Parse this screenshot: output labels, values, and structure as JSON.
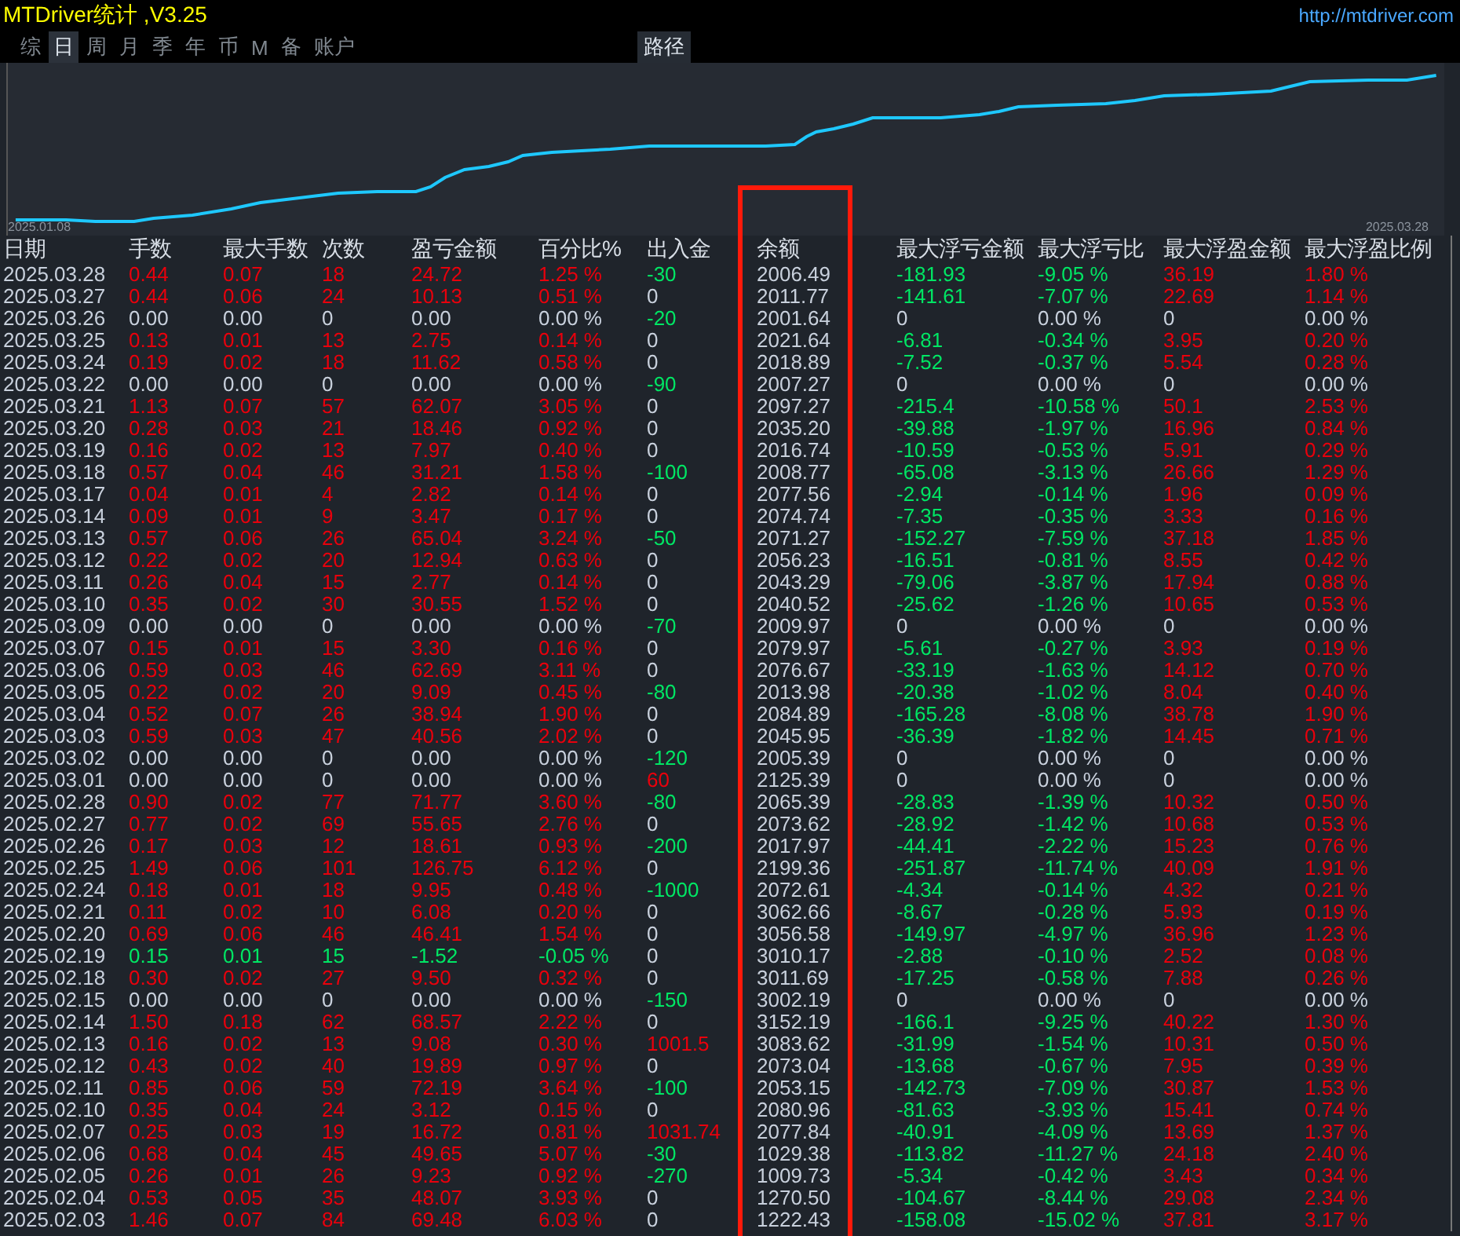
{
  "title": "MTDriver统计 ,V3.25",
  "link": "http://mtdriver.com",
  "tabs": [
    {
      "label": "综",
      "selected": false
    },
    {
      "label": "日",
      "selected": true
    },
    {
      "label": "周",
      "selected": false
    },
    {
      "label": "月",
      "selected": false
    },
    {
      "label": "季",
      "selected": false
    },
    {
      "label": "年",
      "selected": false
    },
    {
      "label": "币",
      "selected": false
    },
    {
      "label": "M",
      "selected": false
    },
    {
      "label": "备",
      "selected": false
    },
    {
      "label": "账户",
      "selected": false
    }
  ],
  "path_button": "路径",
  "chart": {
    "start_label": "2025.01.08",
    "end_label": "2025.03.28"
  },
  "columns": [
    "日期",
    "手数",
    "最大手数",
    "次数",
    "盈亏金额",
    "百分比%",
    "出入金",
    "余额",
    "最大浮亏金额",
    "最大浮亏比",
    "最大浮盈金额",
    "最大浮盈比例"
  ],
  "rows": [
    {
      "date": "2025.03.28",
      "trade": {
        "color": "#e8000c",
        "cells": [
          "0.44",
          "0.07",
          "18",
          "24.72",
          "1.25 %"
        ]
      },
      "cash": {
        "text": "-30",
        "color": "#00e664"
      },
      "balance": "2006.49",
      "float_loss": {
        "color": "#00e664",
        "cells": [
          "-181.93",
          "-9.05 %"
        ]
      },
      "float_profit": {
        "color": "#e8000c",
        "cells": [
          "36.19",
          "1.80 %"
        ]
      }
    },
    {
      "date": "2025.03.27",
      "trade": {
        "color": "#e8000c",
        "cells": [
          "0.44",
          "0.06",
          "24",
          "10.13",
          "0.51 %"
        ]
      },
      "cash": {
        "text": "0",
        "color": "#c8d0dc"
      },
      "balance": "2011.77",
      "float_loss": {
        "color": "#00e664",
        "cells": [
          "-141.61",
          "-7.07 %"
        ]
      },
      "float_profit": {
        "color": "#e8000c",
        "cells": [
          "22.69",
          "1.14 %"
        ]
      }
    },
    {
      "date": "2025.03.26",
      "trade": {
        "color": "#c8d0dc",
        "cells": [
          "0.00",
          "0.00",
          "0",
          "0.00",
          "0.00 %"
        ]
      },
      "cash": {
        "text": "-20",
        "color": "#00e664"
      },
      "balance": "2001.64",
      "float_loss": {
        "color": "#c8d0dc",
        "cells": [
          "0",
          "0.00 %"
        ]
      },
      "float_profit": {
        "color": "#c8d0dc",
        "cells": [
          "0",
          "0.00 %"
        ]
      }
    },
    {
      "date": "2025.03.25",
      "trade": {
        "color": "#e8000c",
        "cells": [
          "0.13",
          "0.01",
          "13",
          "2.75",
          "0.14 %"
        ]
      },
      "cash": {
        "text": "0",
        "color": "#c8d0dc"
      },
      "balance": "2021.64",
      "float_loss": {
        "color": "#00e664",
        "cells": [
          "-6.81",
          "-0.34 %"
        ]
      },
      "float_profit": {
        "color": "#e8000c",
        "cells": [
          "3.95",
          "0.20 %"
        ]
      }
    },
    {
      "date": "2025.03.24",
      "trade": {
        "color": "#e8000c",
        "cells": [
          "0.19",
          "0.02",
          "18",
          "11.62",
          "0.58 %"
        ]
      },
      "cash": {
        "text": "0",
        "color": "#c8d0dc"
      },
      "balance": "2018.89",
      "float_loss": {
        "color": "#00e664",
        "cells": [
          "-7.52",
          "-0.37 %"
        ]
      },
      "float_profit": {
        "color": "#e8000c",
        "cells": [
          "5.54",
          "0.28 %"
        ]
      }
    },
    {
      "date": "2025.03.22",
      "trade": {
        "color": "#c8d0dc",
        "cells": [
          "0.00",
          "0.00",
          "0",
          "0.00",
          "0.00 %"
        ]
      },
      "cash": {
        "text": "-90",
        "color": "#00e664"
      },
      "balance": "2007.27",
      "float_loss": {
        "color": "#c8d0dc",
        "cells": [
          "0",
          "0.00 %"
        ]
      },
      "float_profit": {
        "color": "#c8d0dc",
        "cells": [
          "0",
          "0.00 %"
        ]
      }
    },
    {
      "date": "2025.03.21",
      "trade": {
        "color": "#e8000c",
        "cells": [
          "1.13",
          "0.07",
          "57",
          "62.07",
          "3.05 %"
        ]
      },
      "cash": {
        "text": "0",
        "color": "#c8d0dc"
      },
      "balance": "2097.27",
      "float_loss": {
        "color": "#00e664",
        "cells": [
          "-215.4",
          "-10.58 %"
        ]
      },
      "float_profit": {
        "color": "#e8000c",
        "cells": [
          "50.1",
          "2.53 %"
        ]
      }
    },
    {
      "date": "2025.03.20",
      "trade": {
        "color": "#e8000c",
        "cells": [
          "0.28",
          "0.03",
          "21",
          "18.46",
          "0.92 %"
        ]
      },
      "cash": {
        "text": "0",
        "color": "#c8d0dc"
      },
      "balance": "2035.20",
      "float_loss": {
        "color": "#00e664",
        "cells": [
          "-39.88",
          "-1.97 %"
        ]
      },
      "float_profit": {
        "color": "#e8000c",
        "cells": [
          "16.96",
          "0.84 %"
        ]
      }
    },
    {
      "date": "2025.03.19",
      "trade": {
        "color": "#e8000c",
        "cells": [
          "0.16",
          "0.02",
          "13",
          "7.97",
          "0.40 %"
        ]
      },
      "cash": {
        "text": "0",
        "color": "#c8d0dc"
      },
      "balance": "2016.74",
      "float_loss": {
        "color": "#00e664",
        "cells": [
          "-10.59",
          "-0.53 %"
        ]
      },
      "float_profit": {
        "color": "#e8000c",
        "cells": [
          "5.91",
          "0.29 %"
        ]
      }
    },
    {
      "date": "2025.03.18",
      "trade": {
        "color": "#e8000c",
        "cells": [
          "0.57",
          "0.04",
          "46",
          "31.21",
          "1.58 %"
        ]
      },
      "cash": {
        "text": "-100",
        "color": "#00e664"
      },
      "balance": "2008.77",
      "float_loss": {
        "color": "#00e664",
        "cells": [
          "-65.08",
          "-3.13 %"
        ]
      },
      "float_profit": {
        "color": "#e8000c",
        "cells": [
          "26.66",
          "1.29 %"
        ]
      }
    },
    {
      "date": "2025.03.17",
      "trade": {
        "color": "#e8000c",
        "cells": [
          "0.04",
          "0.01",
          "4",
          "2.82",
          "0.14 %"
        ]
      },
      "cash": {
        "text": "0",
        "color": "#c8d0dc"
      },
      "balance": "2077.56",
      "float_loss": {
        "color": "#00e664",
        "cells": [
          "-2.94",
          "-0.14 %"
        ]
      },
      "float_profit": {
        "color": "#e8000c",
        "cells": [
          "1.96",
          "0.09 %"
        ]
      }
    },
    {
      "date": "2025.03.14",
      "trade": {
        "color": "#e8000c",
        "cells": [
          "0.09",
          "0.01",
          "9",
          "3.47",
          "0.17 %"
        ]
      },
      "cash": {
        "text": "0",
        "color": "#c8d0dc"
      },
      "balance": "2074.74",
      "float_loss": {
        "color": "#00e664",
        "cells": [
          "-7.35",
          "-0.35 %"
        ]
      },
      "float_profit": {
        "color": "#e8000c",
        "cells": [
          "3.33",
          "0.16 %"
        ]
      }
    },
    {
      "date": "2025.03.13",
      "trade": {
        "color": "#e8000c",
        "cells": [
          "0.57",
          "0.06",
          "26",
          "65.04",
          "3.24 %"
        ]
      },
      "cash": {
        "text": "-50",
        "color": "#00e664"
      },
      "balance": "2071.27",
      "float_loss": {
        "color": "#00e664",
        "cells": [
          "-152.27",
          "-7.59 %"
        ]
      },
      "float_profit": {
        "color": "#e8000c",
        "cells": [
          "37.18",
          "1.85 %"
        ]
      }
    },
    {
      "date": "2025.03.12",
      "trade": {
        "color": "#e8000c",
        "cells": [
          "0.22",
          "0.02",
          "20",
          "12.94",
          "0.63 %"
        ]
      },
      "cash": {
        "text": "0",
        "color": "#c8d0dc"
      },
      "balance": "2056.23",
      "float_loss": {
        "color": "#00e664",
        "cells": [
          "-16.51",
          "-0.81 %"
        ]
      },
      "float_profit": {
        "color": "#e8000c",
        "cells": [
          "8.55",
          "0.42 %"
        ]
      }
    },
    {
      "date": "2025.03.11",
      "trade": {
        "color": "#e8000c",
        "cells": [
          "0.26",
          "0.04",
          "15",
          "2.77",
          "0.14 %"
        ]
      },
      "cash": {
        "text": "0",
        "color": "#c8d0dc"
      },
      "balance": "2043.29",
      "float_loss": {
        "color": "#00e664",
        "cells": [
          "-79.06",
          "-3.87 %"
        ]
      },
      "float_profit": {
        "color": "#e8000c",
        "cells": [
          "17.94",
          "0.88 %"
        ]
      }
    },
    {
      "date": "2025.03.10",
      "trade": {
        "color": "#e8000c",
        "cells": [
          "0.35",
          "0.02",
          "30",
          "30.55",
          "1.52 %"
        ]
      },
      "cash": {
        "text": "0",
        "color": "#c8d0dc"
      },
      "balance": "2040.52",
      "float_loss": {
        "color": "#00e664",
        "cells": [
          "-25.62",
          "-1.26 %"
        ]
      },
      "float_profit": {
        "color": "#e8000c",
        "cells": [
          "10.65",
          "0.53 %"
        ]
      }
    },
    {
      "date": "2025.03.09",
      "trade": {
        "color": "#c8d0dc",
        "cells": [
          "0.00",
          "0.00",
          "0",
          "0.00",
          "0.00 %"
        ]
      },
      "cash": {
        "text": "-70",
        "color": "#00e664"
      },
      "balance": "2009.97",
      "float_loss": {
        "color": "#c8d0dc",
        "cells": [
          "0",
          "0.00 %"
        ]
      },
      "float_profit": {
        "color": "#c8d0dc",
        "cells": [
          "0",
          "0.00 %"
        ]
      }
    },
    {
      "date": "2025.03.07",
      "trade": {
        "color": "#e8000c",
        "cells": [
          "0.15",
          "0.01",
          "15",
          "3.30",
          "0.16 %"
        ]
      },
      "cash": {
        "text": "0",
        "color": "#c8d0dc"
      },
      "balance": "2079.97",
      "float_loss": {
        "color": "#00e664",
        "cells": [
          "-5.61",
          "-0.27 %"
        ]
      },
      "float_profit": {
        "color": "#e8000c",
        "cells": [
          "3.93",
          "0.19 %"
        ]
      }
    },
    {
      "date": "2025.03.06",
      "trade": {
        "color": "#e8000c",
        "cells": [
          "0.59",
          "0.03",
          "46",
          "62.69",
          "3.11 %"
        ]
      },
      "cash": {
        "text": "0",
        "color": "#c8d0dc"
      },
      "balance": "2076.67",
      "float_loss": {
        "color": "#00e664",
        "cells": [
          "-33.19",
          "-1.63 %"
        ]
      },
      "float_profit": {
        "color": "#e8000c",
        "cells": [
          "14.12",
          "0.70 %"
        ]
      }
    },
    {
      "date": "2025.03.05",
      "trade": {
        "color": "#e8000c",
        "cells": [
          "0.22",
          "0.02",
          "20",
          "9.09",
          "0.45 %"
        ]
      },
      "cash": {
        "text": "-80",
        "color": "#00e664"
      },
      "balance": "2013.98",
      "float_loss": {
        "color": "#00e664",
        "cells": [
          "-20.38",
          "-1.02 %"
        ]
      },
      "float_profit": {
        "color": "#e8000c",
        "cells": [
          "8.04",
          "0.40 %"
        ]
      }
    },
    {
      "date": "2025.03.04",
      "trade": {
        "color": "#e8000c",
        "cells": [
          "0.52",
          "0.07",
          "26",
          "38.94",
          "1.90 %"
        ]
      },
      "cash": {
        "text": "0",
        "color": "#c8d0dc"
      },
      "balance": "2084.89",
      "float_loss": {
        "color": "#00e664",
        "cells": [
          "-165.28",
          "-8.08 %"
        ]
      },
      "float_profit": {
        "color": "#e8000c",
        "cells": [
          "38.78",
          "1.90 %"
        ]
      }
    },
    {
      "date": "2025.03.03",
      "trade": {
        "color": "#e8000c",
        "cells": [
          "0.59",
          "0.03",
          "47",
          "40.56",
          "2.02 %"
        ]
      },
      "cash": {
        "text": "0",
        "color": "#c8d0dc"
      },
      "balance": "2045.95",
      "float_loss": {
        "color": "#00e664",
        "cells": [
          "-36.39",
          "-1.82 %"
        ]
      },
      "float_profit": {
        "color": "#e8000c",
        "cells": [
          "14.45",
          "0.71 %"
        ]
      }
    },
    {
      "date": "2025.03.02",
      "trade": {
        "color": "#c8d0dc",
        "cells": [
          "0.00",
          "0.00",
          "0",
          "0.00",
          "0.00 %"
        ]
      },
      "cash": {
        "text": "-120",
        "color": "#00e664"
      },
      "balance": "2005.39",
      "float_loss": {
        "color": "#c8d0dc",
        "cells": [
          "0",
          "0.00 %"
        ]
      },
      "float_profit": {
        "color": "#c8d0dc",
        "cells": [
          "0",
          "0.00 %"
        ]
      }
    },
    {
      "date": "2025.03.01",
      "trade": {
        "color": "#c8d0dc",
        "cells": [
          "0.00",
          "0.00",
          "0",
          "0.00",
          "0.00 %"
        ]
      },
      "cash": {
        "text": "60",
        "color": "#e8000c"
      },
      "balance": "2125.39",
      "float_loss": {
        "color": "#c8d0dc",
        "cells": [
          "0",
          "0.00 %"
        ]
      },
      "float_profit": {
        "color": "#c8d0dc",
        "cells": [
          "0",
          "0.00 %"
        ]
      }
    },
    {
      "date": "2025.02.28",
      "trade": {
        "color": "#e8000c",
        "cells": [
          "0.90",
          "0.02",
          "77",
          "71.77",
          "3.60 %"
        ]
      },
      "cash": {
        "text": "-80",
        "color": "#00e664"
      },
      "balance": "2065.39",
      "float_loss": {
        "color": "#00e664",
        "cells": [
          "-28.83",
          "-1.39 %"
        ]
      },
      "float_profit": {
        "color": "#e8000c",
        "cells": [
          "10.32",
          "0.50 %"
        ]
      }
    },
    {
      "date": "2025.02.27",
      "trade": {
        "color": "#e8000c",
        "cells": [
          "0.77",
          "0.02",
          "69",
          "55.65",
          "2.76 %"
        ]
      },
      "cash": {
        "text": "0",
        "color": "#c8d0dc"
      },
      "balance": "2073.62",
      "float_loss": {
        "color": "#00e664",
        "cells": [
          "-28.92",
          "-1.42 %"
        ]
      },
      "float_profit": {
        "color": "#e8000c",
        "cells": [
          "10.68",
          "0.53 %"
        ]
      }
    },
    {
      "date": "2025.02.26",
      "trade": {
        "color": "#e8000c",
        "cells": [
          "0.17",
          "0.03",
          "12",
          "18.61",
          "0.93 %"
        ]
      },
      "cash": {
        "text": "-200",
        "color": "#00e664"
      },
      "balance": "2017.97",
      "float_loss": {
        "color": "#00e664",
        "cells": [
          "-44.41",
          "-2.22 %"
        ]
      },
      "float_profit": {
        "color": "#e8000c",
        "cells": [
          "15.23",
          "0.76 %"
        ]
      }
    },
    {
      "date": "2025.02.25",
      "trade": {
        "color": "#e8000c",
        "cells": [
          "1.49",
          "0.06",
          "101",
          "126.75",
          "6.12 %"
        ]
      },
      "cash": {
        "text": "0",
        "color": "#c8d0dc"
      },
      "balance": "2199.36",
      "float_loss": {
        "color": "#00e664",
        "cells": [
          "-251.87",
          "-11.74 %"
        ]
      },
      "float_profit": {
        "color": "#e8000c",
        "cells": [
          "40.09",
          "1.91 %"
        ]
      }
    },
    {
      "date": "2025.02.24",
      "trade": {
        "color": "#e8000c",
        "cells": [
          "0.18",
          "0.01",
          "18",
          "9.95",
          "0.48 %"
        ]
      },
      "cash": {
        "text": "-1000",
        "color": "#00e664"
      },
      "balance": "2072.61",
      "float_loss": {
        "color": "#00e664",
        "cells": [
          "-4.34",
          "-0.14 %"
        ]
      },
      "float_profit": {
        "color": "#e8000c",
        "cells": [
          "4.32",
          "0.21 %"
        ]
      }
    },
    {
      "date": "2025.02.21",
      "trade": {
        "color": "#e8000c",
        "cells": [
          "0.11",
          "0.02",
          "10",
          "6.08",
          "0.20 %"
        ]
      },
      "cash": {
        "text": "0",
        "color": "#c8d0dc"
      },
      "balance": "3062.66",
      "float_loss": {
        "color": "#00e664",
        "cells": [
          "-8.67",
          "-0.28 %"
        ]
      },
      "float_profit": {
        "color": "#e8000c",
        "cells": [
          "5.93",
          "0.19 %"
        ]
      }
    },
    {
      "date": "2025.02.20",
      "trade": {
        "color": "#e8000c",
        "cells": [
          "0.69",
          "0.06",
          "46",
          "46.41",
          "1.54 %"
        ]
      },
      "cash": {
        "text": "0",
        "color": "#c8d0dc"
      },
      "balance": "3056.58",
      "float_loss": {
        "color": "#00e664",
        "cells": [
          "-149.97",
          "-4.97 %"
        ]
      },
      "float_profit": {
        "color": "#e8000c",
        "cells": [
          "36.96",
          "1.23 %"
        ]
      }
    },
    {
      "date": "2025.02.19",
      "trade": {
        "color": "#00e664",
        "cells": [
          "0.15",
          "0.01",
          "15",
          "-1.52",
          "-0.05 %"
        ]
      },
      "cash": {
        "text": "0",
        "color": "#c8d0dc"
      },
      "balance": "3010.17",
      "float_loss": {
        "color": "#00e664",
        "cells": [
          "-2.88",
          "-0.10 %"
        ]
      },
      "float_profit": {
        "color": "#e8000c",
        "cells": [
          "2.52",
          "0.08 %"
        ]
      }
    },
    {
      "date": "2025.02.18",
      "trade": {
        "color": "#e8000c",
        "cells": [
          "0.30",
          "0.02",
          "27",
          "9.50",
          "0.32 %"
        ]
      },
      "cash": {
        "text": "0",
        "color": "#c8d0dc"
      },
      "balance": "3011.69",
      "float_loss": {
        "color": "#00e664",
        "cells": [
          "-17.25",
          "-0.58 %"
        ]
      },
      "float_profit": {
        "color": "#e8000c",
        "cells": [
          "7.88",
          "0.26 %"
        ]
      }
    },
    {
      "date": "2025.02.15",
      "trade": {
        "color": "#c8d0dc",
        "cells": [
          "0.00",
          "0.00",
          "0",
          "0.00",
          "0.00 %"
        ]
      },
      "cash": {
        "text": "-150",
        "color": "#00e664"
      },
      "balance": "3002.19",
      "float_loss": {
        "color": "#c8d0dc",
        "cells": [
          "0",
          "0.00 %"
        ]
      },
      "float_profit": {
        "color": "#c8d0dc",
        "cells": [
          "0",
          "0.00 %"
        ]
      }
    },
    {
      "date": "2025.02.14",
      "trade": {
        "color": "#e8000c",
        "cells": [
          "1.50",
          "0.18",
          "62",
          "68.57",
          "2.22 %"
        ]
      },
      "cash": {
        "text": "0",
        "color": "#c8d0dc"
      },
      "balance": "3152.19",
      "float_loss": {
        "color": "#00e664",
        "cells": [
          "-166.1",
          "-9.25 %"
        ]
      },
      "float_profit": {
        "color": "#e8000c",
        "cells": [
          "40.22",
          "1.30 %"
        ]
      }
    },
    {
      "date": "2025.02.13",
      "trade": {
        "color": "#e8000c",
        "cells": [
          "0.16",
          "0.02",
          "13",
          "9.08",
          "0.30 %"
        ]
      },
      "cash": {
        "text": "1001.5",
        "color": "#e8000c"
      },
      "balance": "3083.62",
      "float_loss": {
        "color": "#00e664",
        "cells": [
          "-31.99",
          "-1.54 %"
        ]
      },
      "float_profit": {
        "color": "#e8000c",
        "cells": [
          "10.31",
          "0.50 %"
        ]
      }
    },
    {
      "date": "2025.02.12",
      "trade": {
        "color": "#e8000c",
        "cells": [
          "0.43",
          "0.02",
          "40",
          "19.89",
          "0.97 %"
        ]
      },
      "cash": {
        "text": "0",
        "color": "#c8d0dc"
      },
      "balance": "2073.04",
      "float_loss": {
        "color": "#00e664",
        "cells": [
          "-13.68",
          "-0.67 %"
        ]
      },
      "float_profit": {
        "color": "#e8000c",
        "cells": [
          "7.95",
          "0.39 %"
        ]
      }
    },
    {
      "date": "2025.02.11",
      "trade": {
        "color": "#e8000c",
        "cells": [
          "0.85",
          "0.06",
          "59",
          "72.19",
          "3.64 %"
        ]
      },
      "cash": {
        "text": "-100",
        "color": "#00e664"
      },
      "balance": "2053.15",
      "float_loss": {
        "color": "#00e664",
        "cells": [
          "-142.73",
          "-7.09 %"
        ]
      },
      "float_profit": {
        "color": "#e8000c",
        "cells": [
          "30.87",
          "1.53 %"
        ]
      }
    },
    {
      "date": "2025.02.10",
      "trade": {
        "color": "#e8000c",
        "cells": [
          "0.35",
          "0.04",
          "24",
          "3.12",
          "0.15 %"
        ]
      },
      "cash": {
        "text": "0",
        "color": "#c8d0dc"
      },
      "balance": "2080.96",
      "float_loss": {
        "color": "#00e664",
        "cells": [
          "-81.63",
          "-3.93 %"
        ]
      },
      "float_profit": {
        "color": "#e8000c",
        "cells": [
          "15.41",
          "0.74 %"
        ]
      }
    },
    {
      "date": "2025.02.07",
      "trade": {
        "color": "#e8000c",
        "cells": [
          "0.25",
          "0.03",
          "19",
          "16.72",
          "0.81 %"
        ]
      },
      "cash": {
        "text": "1031.74",
        "color": "#e8000c"
      },
      "balance": "2077.84",
      "float_loss": {
        "color": "#00e664",
        "cells": [
          "-40.91",
          "-4.09 %"
        ]
      },
      "float_profit": {
        "color": "#e8000c",
        "cells": [
          "13.69",
          "1.37 %"
        ]
      }
    },
    {
      "date": "2025.02.06",
      "trade": {
        "color": "#e8000c",
        "cells": [
          "0.68",
          "0.04",
          "45",
          "49.65",
          "5.07 %"
        ]
      },
      "cash": {
        "text": "-30",
        "color": "#00e664"
      },
      "balance": "1029.38",
      "float_loss": {
        "color": "#00e664",
        "cells": [
          "-113.82",
          "-11.27 %"
        ]
      },
      "float_profit": {
        "color": "#e8000c",
        "cells": [
          "24.18",
          "2.40 %"
        ]
      }
    },
    {
      "date": "2025.02.05",
      "trade": {
        "color": "#e8000c",
        "cells": [
          "0.26",
          "0.01",
          "26",
          "9.23",
          "0.92 %"
        ]
      },
      "cash": {
        "text": "-270",
        "color": "#00e664"
      },
      "balance": "1009.73",
      "float_loss": {
        "color": "#00e664",
        "cells": [
          "-5.34",
          "-0.42 %"
        ]
      },
      "float_profit": {
        "color": "#e8000c",
        "cells": [
          "3.43",
          "0.34 %"
        ]
      }
    },
    {
      "date": "2025.02.04",
      "trade": {
        "color": "#e8000c",
        "cells": [
          "0.53",
          "0.05",
          "35",
          "48.07",
          "3.93 %"
        ]
      },
      "cash": {
        "text": "0",
        "color": "#c8d0dc"
      },
      "balance": "1270.50",
      "float_loss": {
        "color": "#00e664",
        "cells": [
          "-104.67",
          "-8.44 %"
        ]
      },
      "float_profit": {
        "color": "#e8000c",
        "cells": [
          "29.08",
          "2.34 %"
        ]
      }
    },
    {
      "date": "2025.02.03",
      "trade": {
        "color": "#e8000c",
        "cells": [
          "1.46",
          "0.07",
          "84",
          "69.48",
          "6.03 %"
        ]
      },
      "cash": {
        "text": "0",
        "color": "#c8d0dc"
      },
      "balance": "1222.43",
      "float_loss": {
        "color": "#00e664",
        "cells": [
          "-158.08",
          "-15.02 %"
        ]
      },
      "float_profit": {
        "color": "#e8000c",
        "cells": [
          "37.81",
          "3.17 %"
        ]
      }
    }
  ]
}
